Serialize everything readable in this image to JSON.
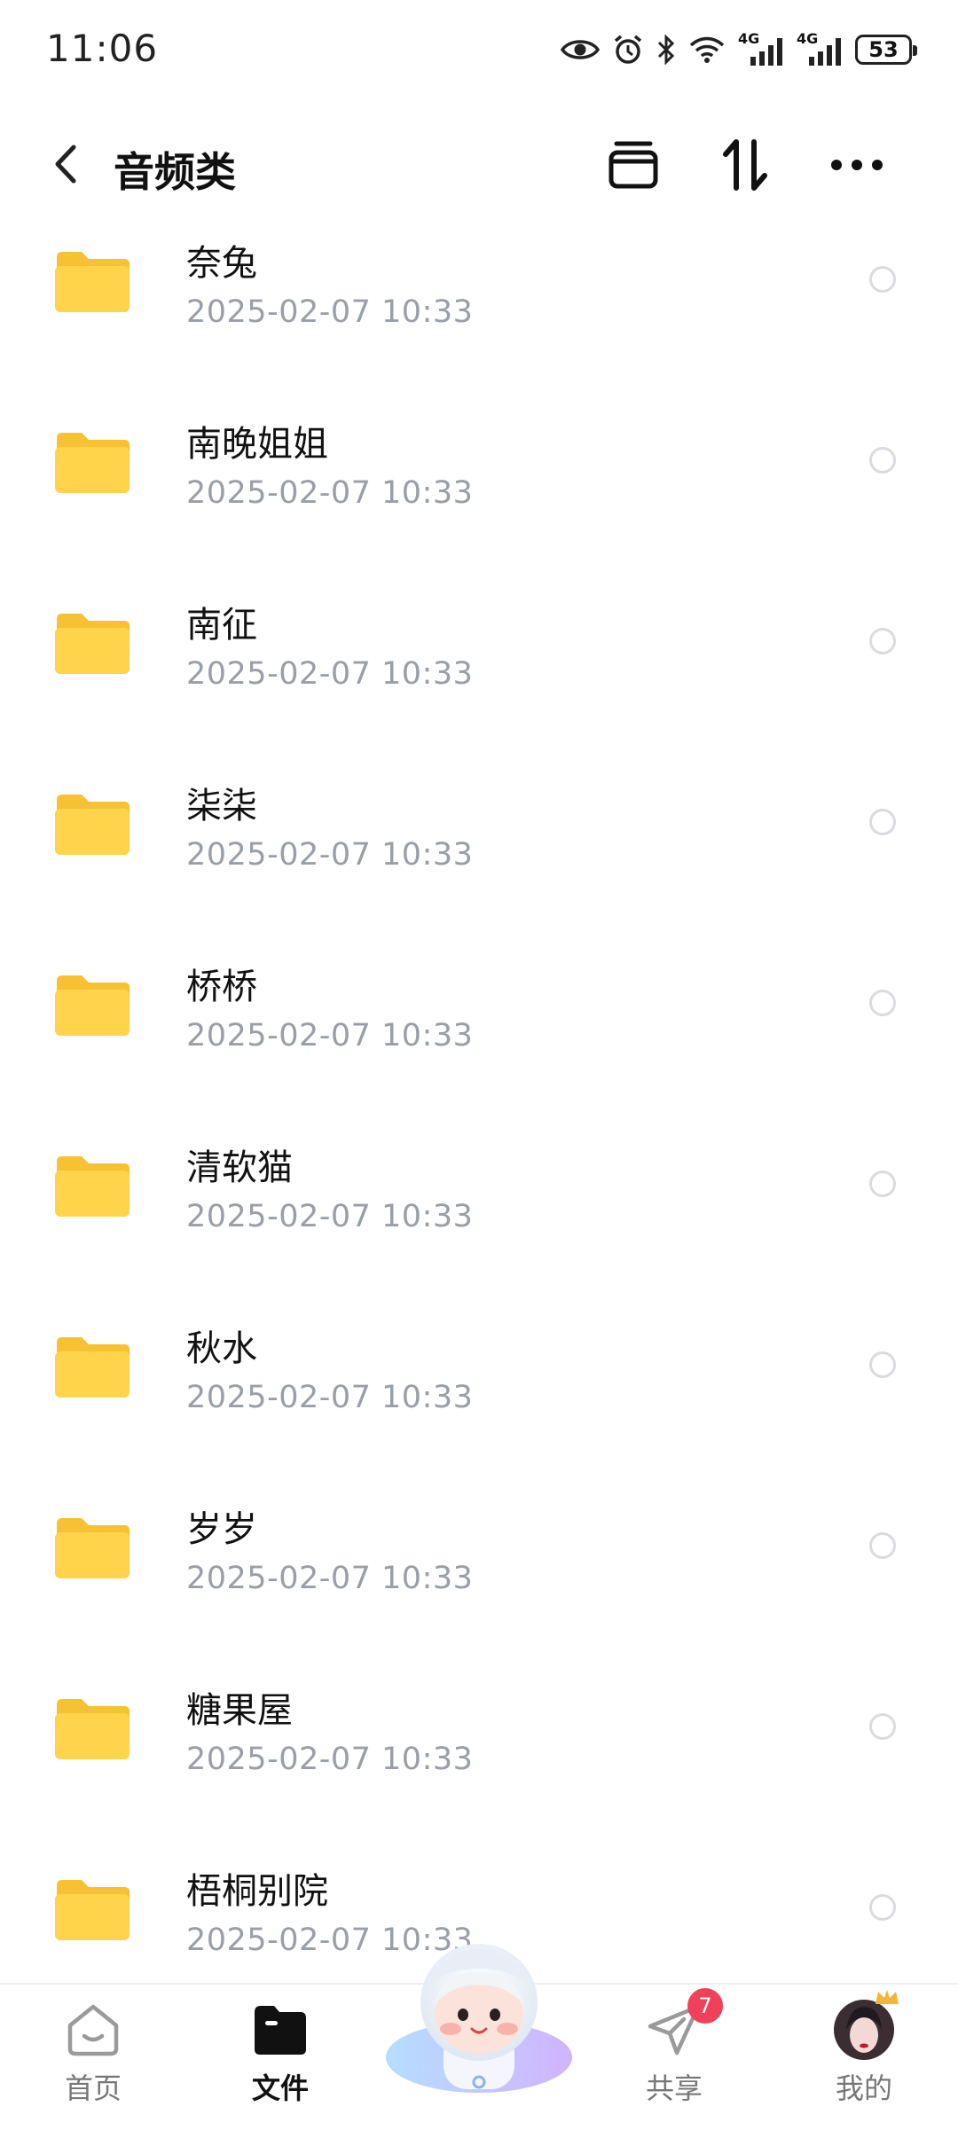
{
  "status_bar": {
    "time": "11:06",
    "network_1": "4G",
    "network_2": "4G",
    "battery": "53"
  },
  "header": {
    "title": "音频类"
  },
  "files": [
    {
      "name": "奈兔",
      "date": "2025-02-07  10:33"
    },
    {
      "name": "南晚姐姐",
      "date": "2025-02-07  10:33"
    },
    {
      "name": "南征",
      "date": "2025-02-07  10:33"
    },
    {
      "name": "柒柒",
      "date": "2025-02-07  10:33"
    },
    {
      "name": "桥桥",
      "date": "2025-02-07  10:33"
    },
    {
      "name": "清软猫",
      "date": "2025-02-07  10:33"
    },
    {
      "name": "秋水",
      "date": "2025-02-07  10:33"
    },
    {
      "name": "岁岁",
      "date": "2025-02-07  10:33"
    },
    {
      "name": "糖果屋",
      "date": "2025-02-07  10:33"
    },
    {
      "name": "梧桐别院",
      "date": "2025-02-07  10:33"
    }
  ],
  "bottom_nav": {
    "home": "首页",
    "files": "文件",
    "share": "共享",
    "share_badge": "7",
    "mine": "我的"
  },
  "colors": {
    "folder": "#ffd34a",
    "badge": "#f1415a",
    "date_text": "#9a9ea6"
  }
}
